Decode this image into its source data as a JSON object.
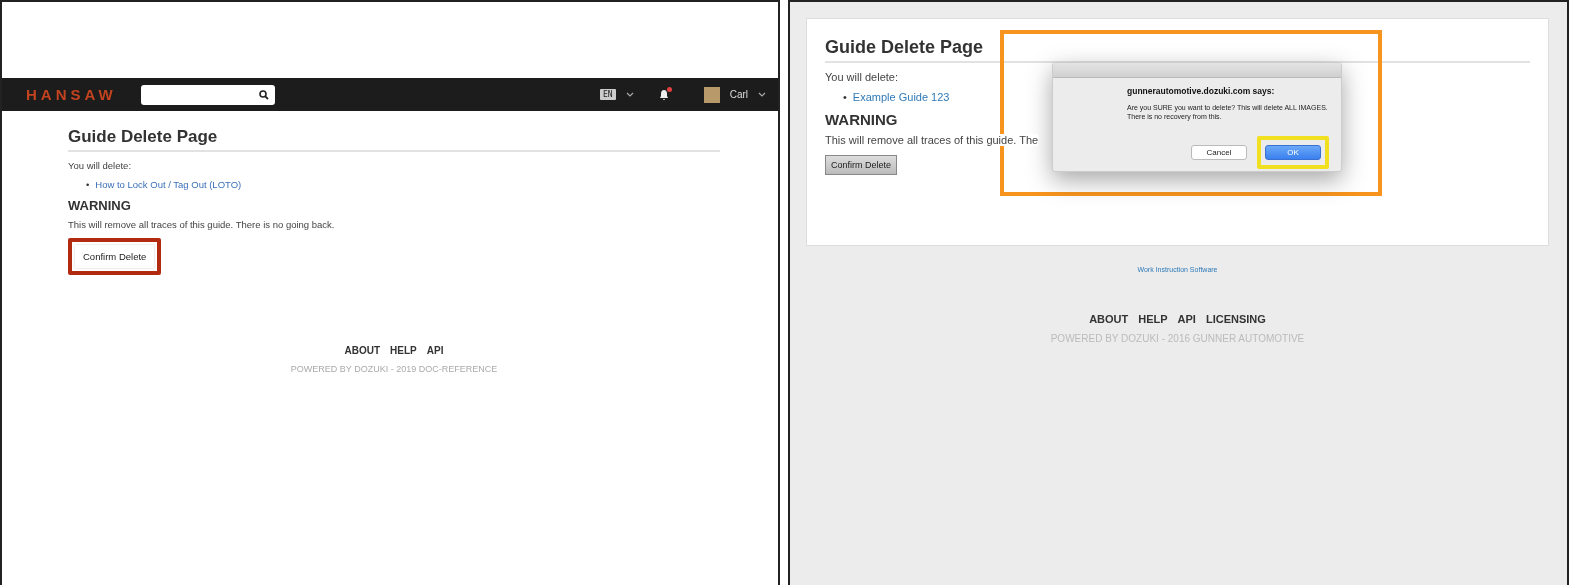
{
  "left_screen": {
    "navbar": {
      "logo": "HANSAW",
      "language": "EN",
      "has_notifications": true,
      "user": "Carl"
    },
    "page": {
      "title": "Guide Delete Page",
      "intro": "You will delete:",
      "items": [
        {
          "marker": "•",
          "label": "How to Lock Out / Tag Out (LOTO)"
        }
      ],
      "warning_heading": "WARNING",
      "warning_text": "This will remove all traces of this guide. There is no going back.",
      "button": {
        "label": "Confirm Delete",
        "highlighted": true
      }
    },
    "footer": {
      "links": [
        "ABOUT",
        "HELP",
        "API"
      ],
      "powered": "POWERED BY DOZUKI - 2019 DOC-REFERENCE"
    }
  },
  "right_screen": {
    "page": {
      "title": "Guide Delete Page",
      "intro": "You will delete:",
      "items": [
        {
          "marker": "•",
          "label": "Example Guide 123"
        }
      ],
      "warning_heading": "WARNING",
      "warning_text": "This will remove all traces of this guide. The",
      "button": {
        "label": "Confirm Delete",
        "highlighted": false
      }
    },
    "dialog": {
      "highlighted": true,
      "title": "gunnerautomotive.dozuki.com says:",
      "message": "Are you SURE you want to delete? This will delete ALL IMAGES. There is no recovery from this.",
      "buttons": [
        {
          "label": "Cancel",
          "default": false,
          "highlighted": false
        },
        {
          "label": "OK",
          "default": true,
          "highlighted": true
        }
      ]
    },
    "credit_link": "Work Instruction Software",
    "footer": {
      "links": [
        "ABOUT",
        "HELP",
        "API",
        "LICENSING"
      ],
      "powered": "POWERED BY DOZUKI - 2016 GUNNER AUTOMOTIVE"
    }
  }
}
